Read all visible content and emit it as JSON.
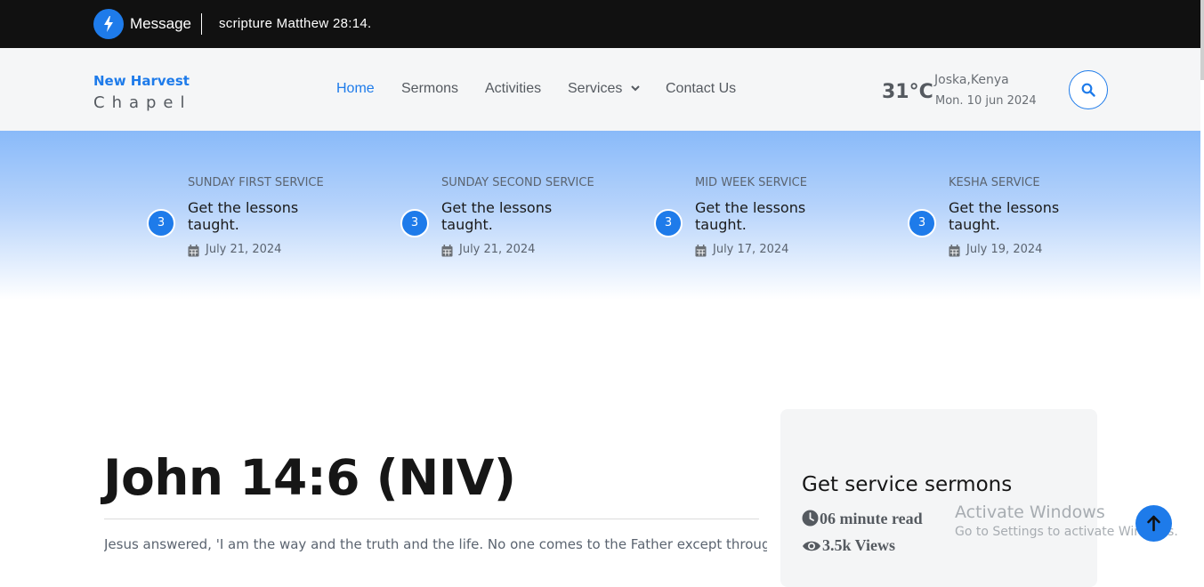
{
  "topbar": {
    "message_label": "Message",
    "message_text": "scripture Matthew 28:14."
  },
  "header": {
    "logo_line1": "New Harvest",
    "logo_line2": "Chapel",
    "nav": [
      {
        "label": "Home",
        "active": true
      },
      {
        "label": "Sermons"
      },
      {
        "label": "Activities"
      },
      {
        "label": "Services"
      },
      {
        "label": "Contact Us"
      }
    ],
    "weather": {
      "temperature": "31°C",
      "location": "Joska,Kenya",
      "date": "Mon. 10 jun 2024"
    }
  },
  "services": [
    {
      "number": "3",
      "category": "SUNDAY FIRST SERVICE",
      "title": "Get the lessons taught.",
      "date": "July 21, 2024"
    },
    {
      "number": "3",
      "category": "SUNDAY SECOND SERVICE",
      "title": "Get the lessons taught.",
      "date": "July 21, 2024"
    },
    {
      "number": "3",
      "category": "MID WEEK SERVICE",
      "title": "Get the lessons taught.",
      "date": "July 17, 2024"
    },
    {
      "number": "3",
      "category": "KESHA SERVICE",
      "title": "Get the lessons taught.",
      "date": "July 19, 2024"
    }
  ],
  "article": {
    "title": "John 14:6 (NIV)",
    "body": "Jesus answered, 'I am the way and the truth and the life. No one comes to the Father except through me"
  },
  "sidebar": {
    "title": "Get service sermons",
    "read_time": "06 minute read",
    "views": "3.5k Views"
  },
  "watermark": {
    "line1": "Activate Windows",
    "line2": "Go to Settings to activate Windows."
  },
  "colors": {
    "accent": "#1e7bea",
    "topbar_bg": "#111111",
    "header_bg": "#f5f6f7"
  },
  "icons": {
    "message": "lightning-bolt-icon",
    "search": "search-icon",
    "calendar": "calendar-icon",
    "clock": "clock-icon",
    "eye": "eye-icon",
    "back_to_top": "arrow-up-icon"
  }
}
